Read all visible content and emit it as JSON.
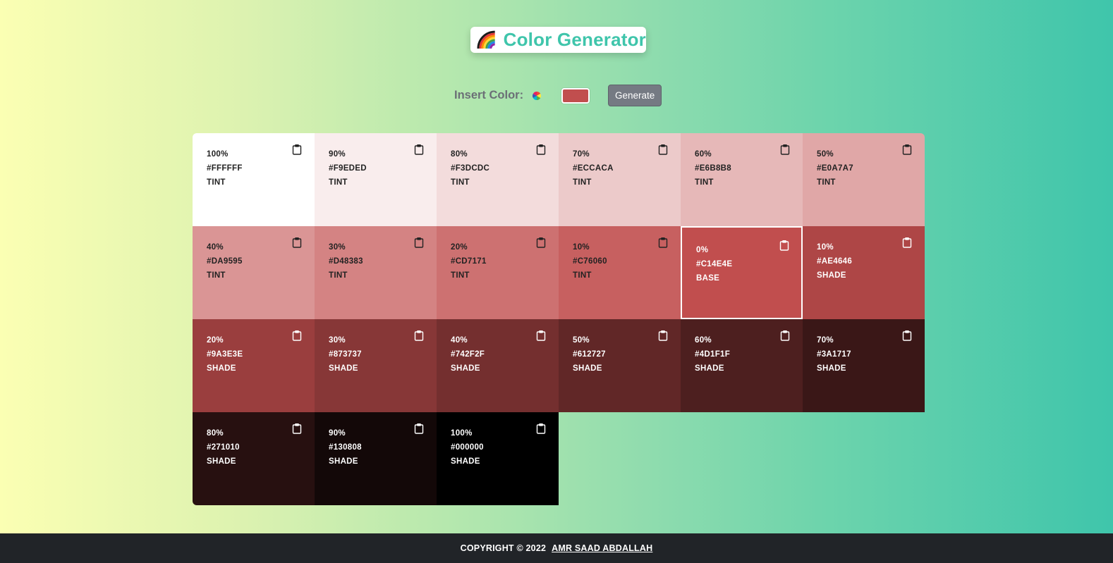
{
  "header": {
    "title": "Color Generator",
    "icon": "rainbow-icon"
  },
  "controls": {
    "label": "Insert Color:",
    "picker_icon": "color-wheel-icon",
    "current_color": "#C14E4E",
    "button_label": "Generate"
  },
  "colors": [
    {
      "percent": "100%",
      "hex": "#FFFFFF",
      "type": "TINT",
      "text": "#222222"
    },
    {
      "percent": "90%",
      "hex": "#F9EDED",
      "type": "TINT",
      "text": "#222222"
    },
    {
      "percent": "80%",
      "hex": "#F3DCDC",
      "type": "TINT",
      "text": "#222222"
    },
    {
      "percent": "70%",
      "hex": "#ECCACA",
      "type": "TINT",
      "text": "#222222"
    },
    {
      "percent": "60%",
      "hex": "#E6B8B8",
      "type": "TINT",
      "text": "#222222"
    },
    {
      "percent": "50%",
      "hex": "#E0A7A7",
      "type": "TINT",
      "text": "#222222"
    },
    {
      "percent": "40%",
      "hex": "#DA9595",
      "type": "TINT",
      "text": "#222222"
    },
    {
      "percent": "30%",
      "hex": "#D48383",
      "type": "TINT",
      "text": "#222222"
    },
    {
      "percent": "20%",
      "hex": "#CD7171",
      "type": "TINT",
      "text": "#222222"
    },
    {
      "percent": "10%",
      "hex": "#C76060",
      "type": "TINT",
      "text": "#222222"
    },
    {
      "percent": "0%",
      "hex": "#C14E4E",
      "type": "BASE",
      "text": "#FFFFFF"
    },
    {
      "percent": "10%",
      "hex": "#AE4646",
      "type": "SHADE",
      "text": "#FFFFFF"
    },
    {
      "percent": "20%",
      "hex": "#9A3E3E",
      "type": "SHADE",
      "text": "#FFFFFF"
    },
    {
      "percent": "30%",
      "hex": "#873737",
      "type": "SHADE",
      "text": "#FFFFFF"
    },
    {
      "percent": "40%",
      "hex": "#742F2F",
      "type": "SHADE",
      "text": "#FFFFFF"
    },
    {
      "percent": "50%",
      "hex": "#612727",
      "type": "SHADE",
      "text": "#FFFFFF"
    },
    {
      "percent": "60%",
      "hex": "#4D1F1F",
      "type": "SHADE",
      "text": "#FFFFFF"
    },
    {
      "percent": "70%",
      "hex": "#3A1717",
      "type": "SHADE",
      "text": "#FFFFFF"
    },
    {
      "percent": "80%",
      "hex": "#271010",
      "type": "SHADE",
      "text": "#FFFFFF"
    },
    {
      "percent": "90%",
      "hex": "#130808",
      "type": "SHADE",
      "text": "#FFFFFF"
    },
    {
      "percent": "100%",
      "hex": "#000000",
      "type": "SHADE",
      "text": "#FFFFFF"
    }
  ],
  "footer": {
    "copyright": "COPYRIGHT © 2022",
    "author": "AMR SAAD ABDALLAH"
  }
}
